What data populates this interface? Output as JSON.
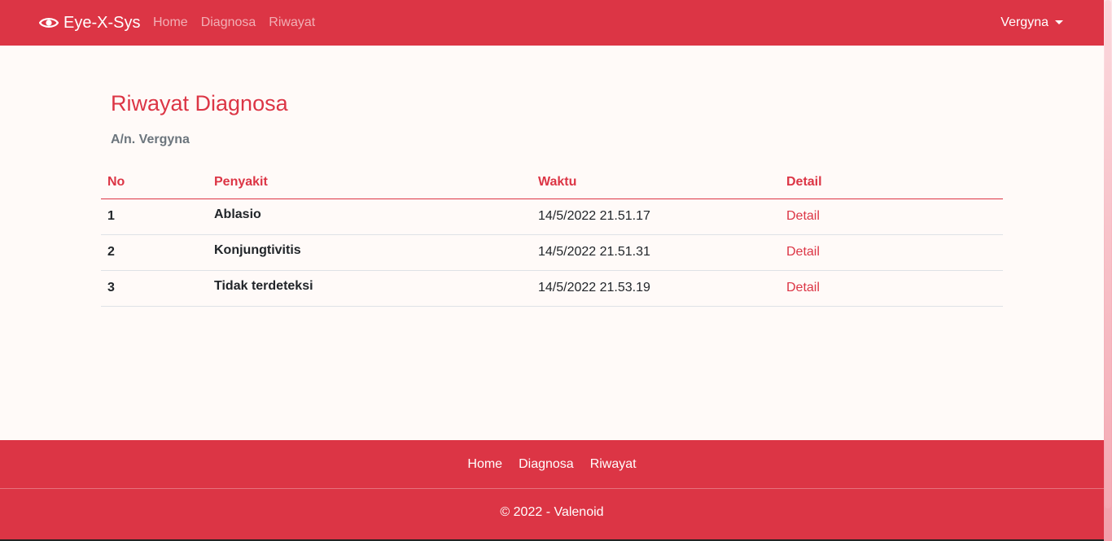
{
  "navbar": {
    "brand": "Eye-X-Sys",
    "links": [
      "Home",
      "Diagnosa",
      "Riwayat"
    ],
    "user": "Vergyna"
  },
  "main": {
    "title": "Riwayat Diagnosa",
    "subtitle": "A/n. Vergyna",
    "table": {
      "headers": [
        "No",
        "Penyakit",
        "Waktu",
        "Detail"
      ],
      "rows": [
        {
          "no": "1",
          "penyakit": "Ablasio",
          "waktu": "14/5/2022 21.51.17",
          "detail": "Detail"
        },
        {
          "no": "2",
          "penyakit": "Konjungtivitis",
          "waktu": "14/5/2022 21.51.31",
          "detail": "Detail"
        },
        {
          "no": "3",
          "penyakit": "Tidak terdeteksi",
          "waktu": "14/5/2022 21.53.19",
          "detail": "Detail"
        }
      ]
    }
  },
  "footer": {
    "links": [
      "Home",
      "Diagnosa",
      "Riwayat"
    ],
    "copyright": "© 2022 - Valenoid"
  },
  "colors": {
    "primary": "#dc3545",
    "background": "#fffaf8",
    "muted": "#6c757d"
  },
  "icons": {
    "brand": "eye-icon",
    "user_menu": "caret-down-icon"
  }
}
